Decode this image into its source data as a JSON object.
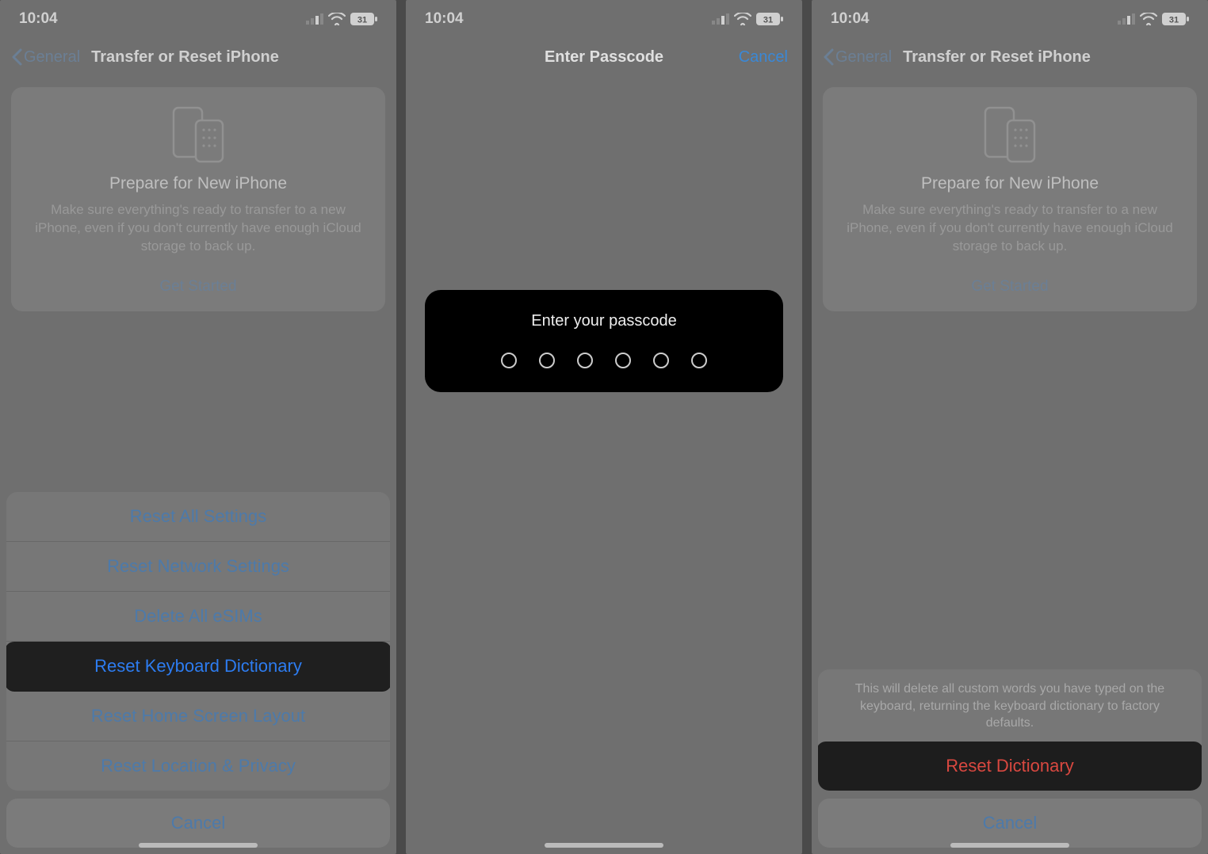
{
  "status": {
    "time": "10:04",
    "battery": "31"
  },
  "screen1": {
    "back_label": "General",
    "title": "Transfer or Reset iPhone",
    "card": {
      "title": "Prepare for New iPhone",
      "desc": "Make sure everything's ready to transfer to a new iPhone, even if you don't currently have enough iCloud storage to back up.",
      "cta": "Get Started"
    },
    "sheet": {
      "items": [
        "Reset All Settings",
        "Reset Network Settings",
        "Delete All eSIMs",
        "Reset Keyboard Dictionary",
        "Reset Home Screen Layout",
        "Reset Location & Privacy"
      ],
      "highlight_index": 3,
      "cancel": "Cancel"
    }
  },
  "screen2": {
    "title": "Enter Passcode",
    "cancel": "Cancel",
    "prompt": "Enter your passcode",
    "length": 6
  },
  "screen3": {
    "back_label": "General",
    "title": "Transfer or Reset iPhone",
    "card": {
      "title": "Prepare for New iPhone",
      "desc": "Make sure everything's ready to transfer to a new iPhone, even if you don't currently have enough iCloud storage to back up.",
      "cta": "Get Started"
    },
    "confirm": {
      "message": "This will delete all custom words you have typed on the keyboard, returning the keyboard dictionary to factory defaults.",
      "action": "Reset Dictionary",
      "cancel": "Cancel"
    }
  }
}
